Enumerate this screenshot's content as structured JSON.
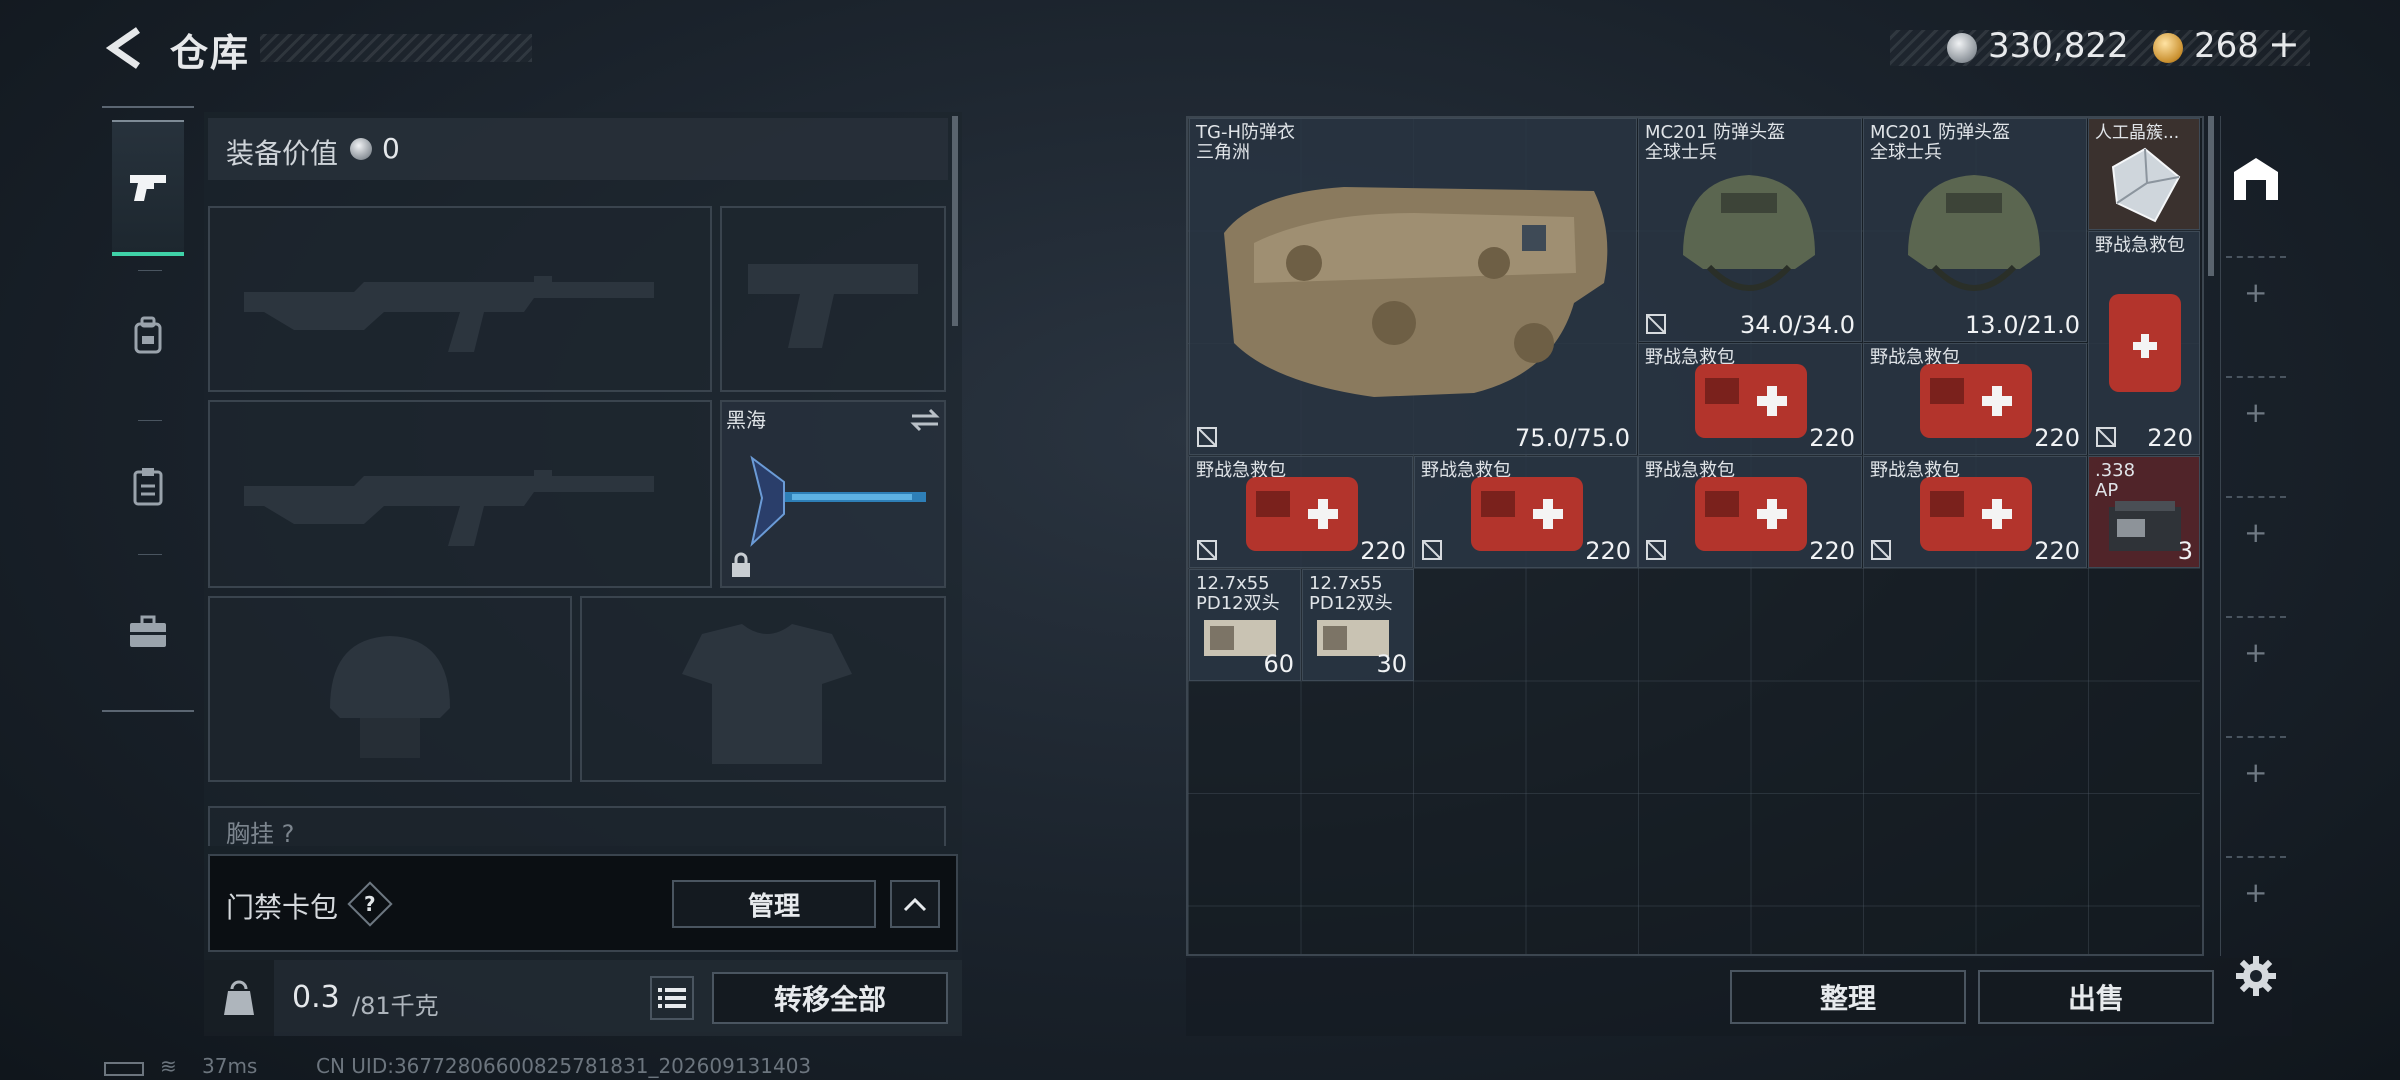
{
  "header": {
    "title": "仓库",
    "back_icon": "chevron-left-icon"
  },
  "currency": {
    "silver": "330,822",
    "gold": "268",
    "plus": "+"
  },
  "tabs": [
    {
      "name": "weapons",
      "icon": "pistol-icon",
      "active": true
    },
    {
      "name": "gear",
      "icon": "backpack-icon",
      "active": false
    },
    {
      "name": "items",
      "icon": "clipboard-icon",
      "active": false
    },
    {
      "name": "tools",
      "icon": "briefcase-icon",
      "active": false
    }
  ],
  "equipment": {
    "value_label": "装备价值",
    "value": "0",
    "melee_name": "黑海",
    "chest_label": "胸挂 ?"
  },
  "keycard": {
    "label": "门禁卡包",
    "help": "?",
    "manage": "管理"
  },
  "capacity": {
    "current": "0.3",
    "max": "/81千克",
    "transfer_all": "转移全部"
  },
  "status": {
    "ping": "37ms",
    "uid": "CN UID:36772806600825781831_202609131403"
  },
  "stash": {
    "items": [
      {
        "id": "vest",
        "name": "TG-H防弹衣\n三角洲",
        "value": "75.0/75.0"
      },
      {
        "id": "helmet-1",
        "name": "MC201 防弹头盔\n全球士兵",
        "value": "34.0/34.0"
      },
      {
        "id": "helmet-2",
        "name": "MC201 防弹头盔\n全球士兵",
        "value": "13.0/21.0"
      },
      {
        "id": "crystal",
        "name": "人工晶簇...",
        "value": ""
      },
      {
        "id": "medkit-tall",
        "name": "野战急救包",
        "value": "220"
      },
      {
        "id": "medkit-a",
        "name": "野战急救包",
        "value": "220"
      },
      {
        "id": "medkit-b",
        "name": "野战急救包",
        "value": "220"
      },
      {
        "id": "medkit-c",
        "name": "野战急救包",
        "value": "220"
      },
      {
        "id": "medkit-d",
        "name": "野战急救包",
        "value": "220"
      },
      {
        "id": "medkit-e",
        "name": "野战急救包",
        "value": "220"
      },
      {
        "id": "medkit-f",
        "name": "野战急救包",
        "value": "220"
      },
      {
        "id": "ammo-338",
        "name": ".338\nAP",
        "value": "3"
      },
      {
        "id": "ammo-127-a",
        "name": "12.7x55\nPD12双头",
        "value": "60"
      },
      {
        "id": "ammo-127-b",
        "name": "12.7x55\nPD12双头",
        "value": "30"
      }
    ],
    "sort": "整理",
    "sell": "出售"
  },
  "colors": {
    "accent": "#3fd2a8",
    "red_item": "#56262a",
    "item_bg": "#2a3644"
  }
}
